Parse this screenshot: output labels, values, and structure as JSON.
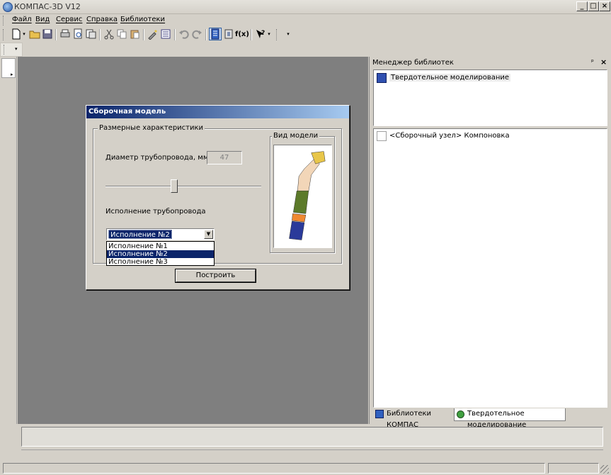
{
  "window": {
    "title": "КОМПАС-3D V12",
    "buttons": [
      "_",
      "□",
      "×"
    ]
  },
  "menu": [
    "Файл",
    "Вид",
    "Сервис",
    "Справка",
    "Библиотеки"
  ],
  "toolbar": {
    "icons": [
      "new-document-icon",
      "open-folder-icon",
      "save-icon",
      "print-icon",
      "print-preview-icon",
      "export-icon",
      "cut-icon",
      "copy-icon",
      "paste-icon",
      "properties-icon",
      "tree-view-icon",
      "undo-icon",
      "redo-icon",
      "library-manager-icon",
      "variables-icon",
      "function-icon",
      "help-pointer-icon"
    ]
  },
  "dialog": {
    "title": "Сборочная модель",
    "group_label": "Размерные характеристики",
    "diameter_label": "Диаметр трубопровода, мм",
    "diameter_value": "47",
    "slider_level": 0.44,
    "variant_label": "Исполнение трубопровода",
    "variant_selected": "Исполнение №2",
    "variant_options": [
      "Исполнение №1",
      "Исполнение №2",
      "Исполнение №3"
    ],
    "preview_label": "Вид модели",
    "build_button": "Построить",
    "model_colors": {
      "flange_top": "#e8c64a",
      "elbow": "#f2d6b8",
      "hose": "#5c7a2a",
      "ring": "#f08830",
      "bottom": "#2a3a9a"
    }
  },
  "library_manager": {
    "title": "Менеджер библиотек",
    "tree_item": "Твердотельное моделирование",
    "list_item": "<Сборочный узел> Компоновка",
    "tabs": [
      "Библиотеки КОМПАС",
      "Твердотельное моделирование"
    ]
  }
}
